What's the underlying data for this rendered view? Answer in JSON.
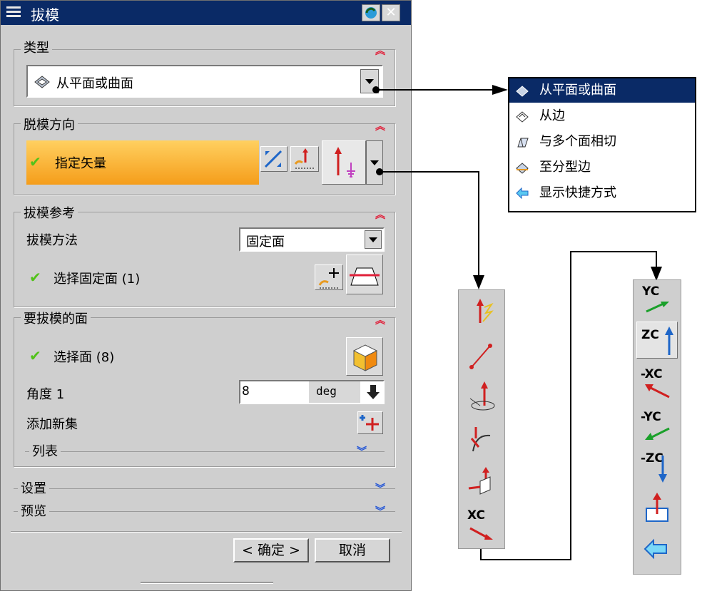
{
  "dialog": {
    "title": "拔模",
    "type_group": {
      "title": "类型",
      "selected": "从平面或曲面"
    },
    "direction_group": {
      "title": "脱模方向",
      "specify_vector": "指定矢量"
    },
    "reference_group": {
      "title": "拔模参考",
      "method_label": "拔模方法",
      "method_value": "固定面",
      "select_fixed": "选择固定面 (1)"
    },
    "faces_group": {
      "title": "要拔模的面",
      "select_faces": "选择面 (8)",
      "angle_label": "角度 1",
      "angle_value": "8",
      "angle_unit": "deg",
      "add_set": "添加新集",
      "list_title": "列表"
    },
    "settings_title": "设置",
    "preview_title": "预览",
    "ok_label": "< 确定 >",
    "cancel_label": "取消"
  },
  "type_menu": {
    "items": [
      {
        "label": "从平面或曲面",
        "selected": true
      },
      {
        "label": "从边",
        "selected": false
      },
      {
        "label": "与多个面相切",
        "selected": false
      },
      {
        "label": "至分型边",
        "selected": false
      },
      {
        "label": "显示快捷方式",
        "selected": false
      }
    ]
  },
  "vector_toolbar": {
    "xc_label": "XC"
  },
  "axis_toolbar": {
    "labels": [
      "YC",
      "ZC",
      "-XC",
      "-YC",
      "-ZC"
    ]
  },
  "colors": {
    "titlebar": "#0a2a66",
    "accent_orange": "#f5a623",
    "check_green": "#52c21a",
    "chevron_red": "#e0203a"
  }
}
